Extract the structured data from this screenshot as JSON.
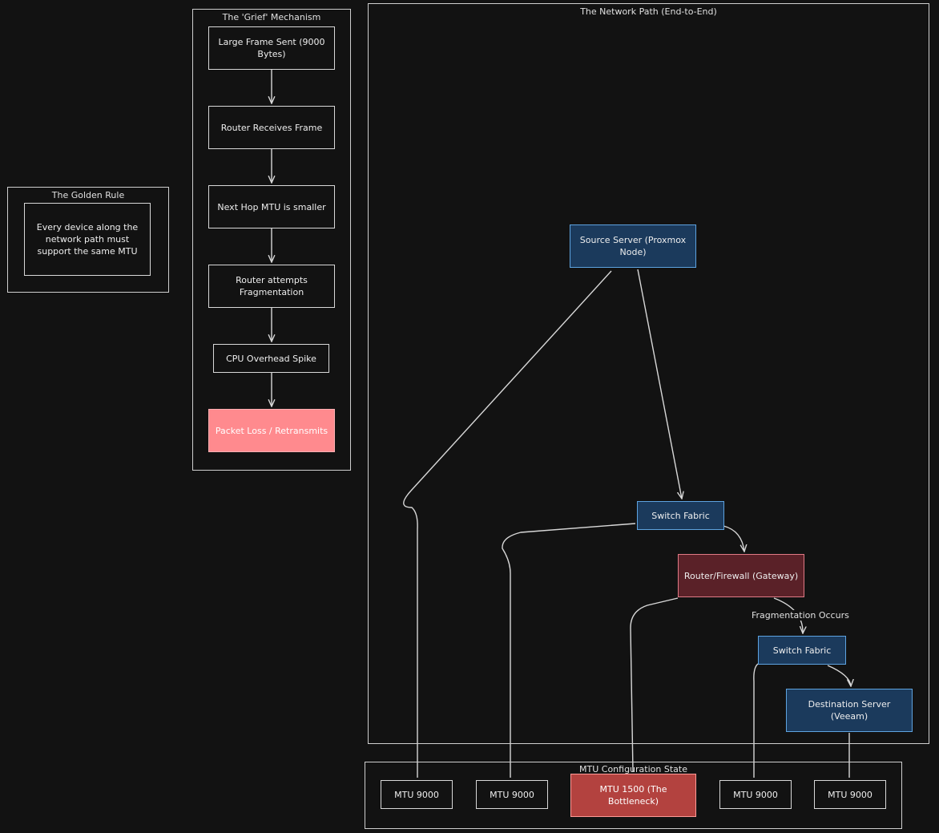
{
  "clusters": {
    "golden_rule": {
      "title": "The Golden Rule"
    },
    "grief": {
      "title": "The 'Grief' Mechanism"
    },
    "network_path": {
      "title": "The Network Path (End-to-End)"
    },
    "mtu_state": {
      "title": "MTU Configuration State"
    }
  },
  "nodes": {
    "golden_rule_text": "Every device along the network path must support the same MTU",
    "large_frame": "Large Frame Sent (9000 Bytes)",
    "router_receives": "Router Receives Frame",
    "next_hop": "Next Hop MTU is smaller",
    "router_attempts": "Router attempts Fragmentation",
    "cpu_spike": "CPU Overhead Spike",
    "packet_loss": "Packet Loss / Retransmits",
    "source_server": "Source Server (Proxmox Node)",
    "switch_fabric_1": "Switch Fabric",
    "router_firewall": "Router/Firewall (Gateway)",
    "switch_fabric_2": "Switch Fabric",
    "destination_server": "Destination Server (Veeam)",
    "mtu_1": "MTU 9000",
    "mtu_2": "MTU 9000",
    "mtu_bottleneck": "MTU 1500 (The Bottleneck)",
    "mtu_4": "MTU 9000",
    "mtu_5": "MTU 9000"
  },
  "edge_labels": {
    "fragmentation": "Fragmentation Occurs"
  },
  "colors": {
    "background": "#121212",
    "line": "#d0d0d0",
    "blue_fill": "#1b3a5c",
    "blue_stroke": "#5ea3e0",
    "maroon_fill": "#5a2128",
    "pink_fill": "#ff8a8e",
    "red_fill": "#b3423f"
  }
}
